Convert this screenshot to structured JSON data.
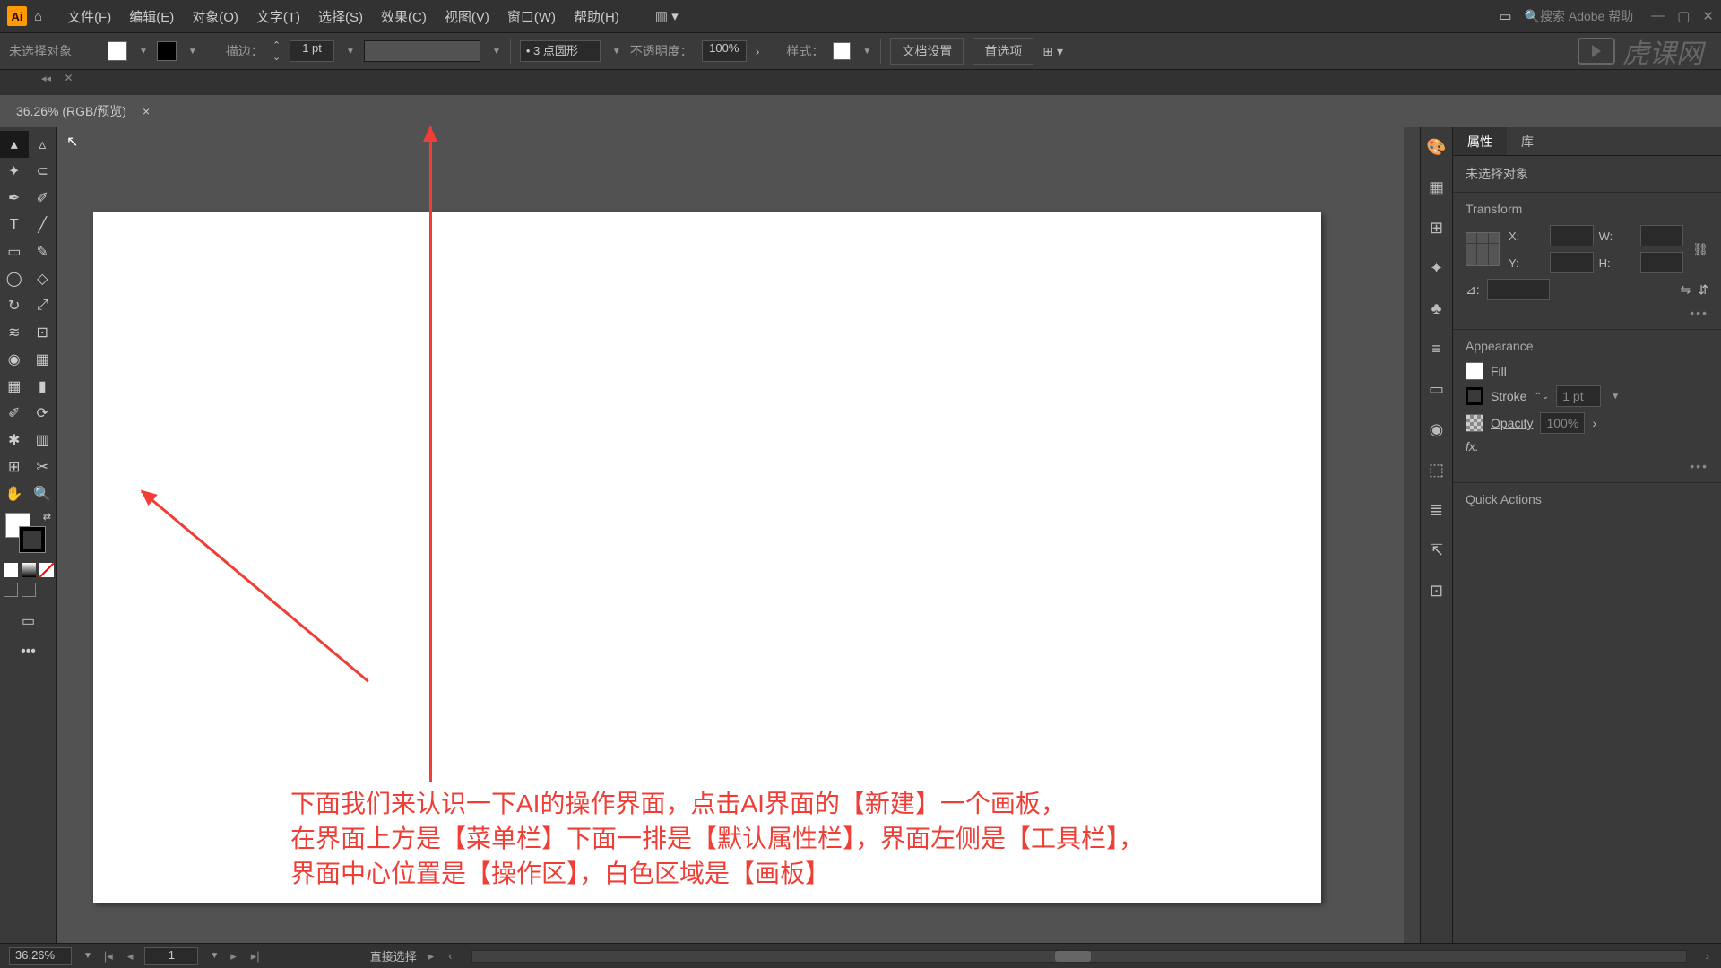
{
  "menubar": {
    "items": [
      "文件(F)",
      "编辑(E)",
      "对象(O)",
      "文字(T)",
      "选择(S)",
      "效果(C)",
      "视图(V)",
      "窗口(W)",
      "帮助(H)"
    ],
    "search_placeholder": "搜索 Adobe 帮助"
  },
  "controlbar": {
    "no_selection": "未选择对象",
    "stroke_label": "描边：",
    "stroke_value": "1 pt",
    "dash_preset": "3 点圆形",
    "opacity_label": "不透明度：",
    "opacity_value": "100%",
    "style_label": "样式：",
    "doc_setup": "文档设置",
    "prefs": "首选项"
  },
  "document": {
    "tab_title": "36.26% (RGB/预览)"
  },
  "right_panel": {
    "tabs": [
      "属性",
      "库"
    ],
    "no_selection": "未选择对象",
    "transform_title": "Transform",
    "transform": {
      "x_label": "X:",
      "x_val": "",
      "y_label": "Y:",
      "y_val": "",
      "w_label": "W:",
      "w_val": "",
      "h_label": "H:",
      "h_val": "",
      "angle_label": "⊿:"
    },
    "appearance_title": "Appearance",
    "fill_label": "Fill",
    "stroke_label": "Stroke",
    "stroke_value": "1 pt",
    "opacity_label": "Opacity",
    "opacity_value": "100%",
    "fx_label": "fx.",
    "quick_actions": "Quick Actions"
  },
  "annotation": {
    "line1": "下面我们来认识一下AI的操作界面，点击AI界面的【新建】一个画板，",
    "line2": "在界面上方是【菜单栏】下面一排是【默认属性栏】，界面左侧是【工具栏】，",
    "line3": "界面中心位置是【操作区】，白色区域是【画板】"
  },
  "statusbar": {
    "zoom": "36.26%",
    "artboard": "1",
    "tool_hint": "直接选择"
  },
  "watermark": "虎课网"
}
